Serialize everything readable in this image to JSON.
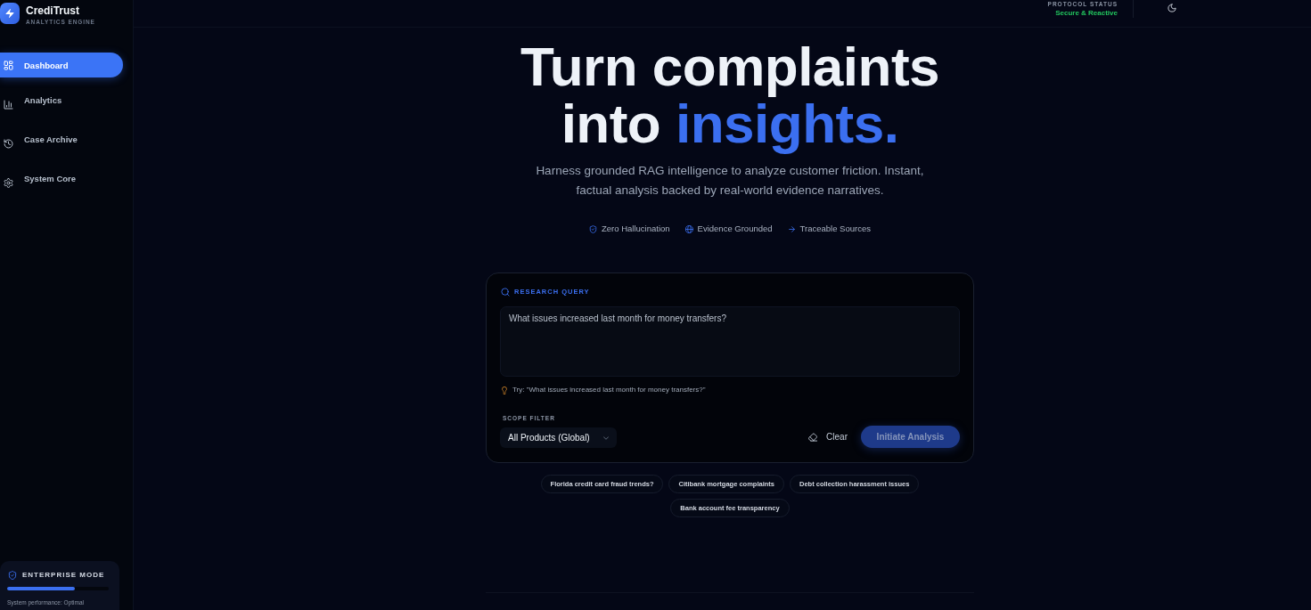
{
  "sidebar": {
    "brand": {
      "name": "CrediTrust",
      "tagline": "ANALYTICS ENGINE"
    },
    "items": [
      {
        "label": "Dashboard",
        "selected": true
      },
      {
        "label": "Analytics",
        "selected": false
      },
      {
        "label": "Case Archive",
        "selected": false
      },
      {
        "label": "System Core",
        "selected": false
      }
    ],
    "enterprise_panel": {
      "title": "ENTERPRISE MODE",
      "level": 0.67,
      "note": "System performance: Optimal"
    }
  },
  "header": {
    "status_label": "PROTOCOL STATUS",
    "status_value": "Secure & Reactive"
  },
  "hero": {
    "title": "Turn complaints into",
    "title_highlight": "insights.",
    "subtitle": "Harness grounded RAG intelligence to analyze customer friction. Instant, factual analysis backed by real-world evidence narratives.",
    "features": [
      "Zero Hallucination",
      "Evidence Grounded",
      "Traceable Sources"
    ]
  },
  "query_card": {
    "label": "RESEARCH QUERY",
    "placeholder": "What issues increased last month for money transfers?",
    "hint": "Try: \"What issues increased last month for money transfers?\"",
    "scope_label": "SCOPE FILTER",
    "scope_value": "All Products (Global)",
    "clear_button": "Clear",
    "submit_button": {
      "label": "Initiate Analysis",
      "disabled": true
    }
  },
  "suggestions": [
    "Florida credit card fraud trends?",
    "Citibank mortgage complaints",
    "Debt collection harassment issues",
    "Bank account fee transparency"
  ]
}
